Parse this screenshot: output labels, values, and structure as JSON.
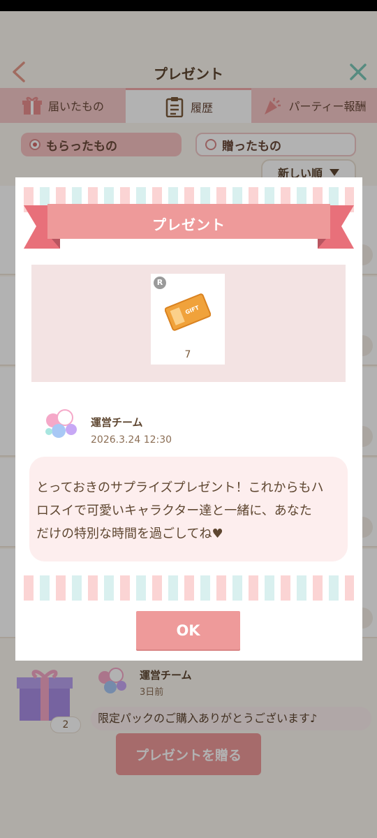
{
  "header": {
    "title": "プレゼント"
  },
  "tabs": [
    {
      "label": "届いたもの",
      "icon": "gift-icon"
    },
    {
      "label": "履歴",
      "icon": "clipboard-icon",
      "active": true
    },
    {
      "label": "パーティー報酬",
      "icon": "party-popper-icon"
    }
  ],
  "filters": {
    "received_label": "もらったもの",
    "sent_label": "贈ったもの",
    "selected": "もらったもの"
  },
  "sort": {
    "label": "新しい順"
  },
  "list": {
    "last_item": {
      "sender": "運営チーム",
      "time": "3日前",
      "message": "限定パックのご購入ありがとうございます♪",
      "count": "2"
    }
  },
  "send_button": {
    "label": "プレゼントを贈る"
  },
  "modal": {
    "title": "プレゼント",
    "item": {
      "rarity": "R",
      "icon": "gift-ticket-icon",
      "ticket_text": "GIFT",
      "count": "7"
    },
    "sender": "運営チーム",
    "sent_at": "2026.3.24 12:30",
    "message_line1": "とっておきのサプライズプレゼント！これからもハ",
    "message_line2": "ロスイで可愛いキャラクター達と一緒に、あなた",
    "message_line3": "だけの特別な時間を過ごしてね♥",
    "ok_label": "OK"
  },
  "colors": {
    "accent": "#ee9a9a",
    "tab_inactive": "#f5c9c9",
    "stripe_pink": "#fbd4d4",
    "stripe_mint": "#d9f0ef",
    "message_bg": "#fdeeee",
    "text_brown": "#5e4630"
  }
}
